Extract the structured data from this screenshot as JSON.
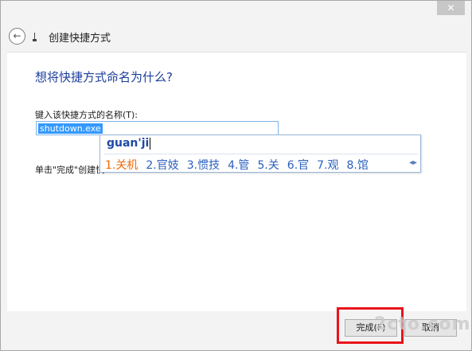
{
  "window": {
    "close_glyph": "✕",
    "title": "创建快捷方式"
  },
  "content": {
    "heading": "想将快捷方式命名为什么?",
    "field_label": "键入该快捷方式的名称(T):",
    "field_value": "shutdown.exe",
    "hint": "单击\"完成\"创建快"
  },
  "ime": {
    "composition": "guan'ji",
    "candidates": [
      "1.关机",
      "2.官妓",
      "3.惯技",
      "4.管",
      "5.关",
      "6.官",
      "7.观",
      "8.馆"
    ],
    "nav_glyph": "◂▸"
  },
  "footer": {
    "finish_label": "完成(F)",
    "cancel_label": "取消"
  },
  "watermark": "2cto.com",
  "colors": {
    "heading": "#1c3d9b",
    "selection": "#3399ff",
    "candidate_selected": "#f06a0a",
    "candidate": "#2c5fbf",
    "highlight": "#e8141b"
  }
}
